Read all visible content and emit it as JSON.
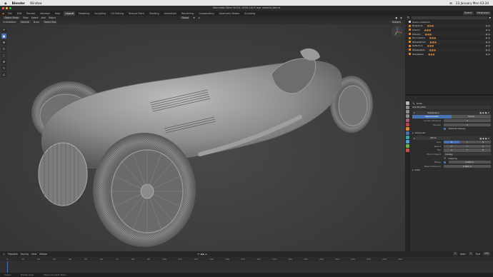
{
  "macbar": {
    "apple": "",
    "app": "Blender",
    "menu": "Window",
    "clock": "23 January Mon 03:34"
  },
  "window_title": "Mercedes Benz W154 1938 (v8.9 rear wheels).blend",
  "topbar": {
    "menus": [
      "File",
      "Edit",
      "Render",
      "Window",
      "Help"
    ],
    "workspaces": [
      "Layout",
      "Modeling",
      "Sculpting",
      "UV Editing",
      "Texture Paint",
      "Shading",
      "Animation",
      "Rendering",
      "Compositing",
      "Geometry Nodes",
      "Scripting"
    ],
    "active_workspace": "Layout",
    "scene": "Scene",
    "view_layer": "ViewLayer"
  },
  "viewport_header": {
    "mode": "Object Mode",
    "menus": [
      "View",
      "Select",
      "Add",
      "Object"
    ],
    "orientation": "Global",
    "options": "Options"
  },
  "viewport_header2": {
    "orientation_label": "Orientation:",
    "orientation": "Default",
    "drag_label": "Drag:",
    "drag": "Select Box"
  },
  "toolbar_tools": [
    "cursor",
    "select",
    "move",
    "rotate",
    "scale",
    "transform",
    "annotate",
    "measure"
  ],
  "outliner": {
    "title": "Scene Collection",
    "rows": [
      {
        "label": "Bodywork",
        "type": "mesh"
      },
      {
        "label": "Interior",
        "type": "mesh"
      },
      {
        "label": "Exterior",
        "type": "mesh"
      },
      {
        "label": "Decorations",
        "type": "mesh"
      },
      {
        "label": "WheelsFront",
        "type": "mesh"
      },
      {
        "label": "Reflectors",
        "type": "mesh"
      },
      {
        "label": "WheelsRear",
        "type": "mesh"
      },
      {
        "label": "WheelRear",
        "type": "mesh"
      }
    ]
  },
  "properties": {
    "object_name": "Grille",
    "modifier_label": "Add Modifier",
    "subdivision": {
      "name": "Subdivision",
      "types": [
        "Catmull-Clark",
        "Simple"
      ],
      "active_type": "Catmull-Clark",
      "levels_viewport_label": "Levels Viewport",
      "levels_viewport": "1",
      "render_label": "Render",
      "render": "2",
      "optimal_display": "Optimal Display",
      "advanced": "Advanced"
    },
    "mirror": {
      "name": "Mirror",
      "axis_label": "Axis",
      "bisect_label": "Bisect",
      "flip_label": "Flip",
      "axes": [
        "X",
        "Y",
        "Z"
      ],
      "mirror_object_label": "Mirror Object",
      "mirror_object": "Canopy",
      "clipping": "Clipping",
      "merge_label": "Merge",
      "merge": "0.001 m",
      "bisect_distance_label": "Bisect Distance",
      "bisect_distance": "0.001 m",
      "data": "Data"
    }
  },
  "timeline": {
    "menus": [
      "Playback",
      "Keying",
      "View",
      "Marker"
    ],
    "current_frame": "1",
    "start_label": "Start",
    "start": "1",
    "end_label": "End",
    "end": "250",
    "ticks": [
      "0",
      "10",
      "20",
      "30",
      "40",
      "50",
      "60",
      "70",
      "80",
      "90",
      "100",
      "110",
      "120",
      "130",
      "140",
      "150",
      "160",
      "170",
      "180",
      "190",
      "200",
      "210",
      "220",
      "230",
      "240",
      "250"
    ]
  },
  "statusbar": [
    "Select",
    "Rotate View",
    "Object Context Menu"
  ],
  "colors": {
    "accent": "#4772b3",
    "mesh": "#d48a3a",
    "panel": "#2d2d2d"
  }
}
